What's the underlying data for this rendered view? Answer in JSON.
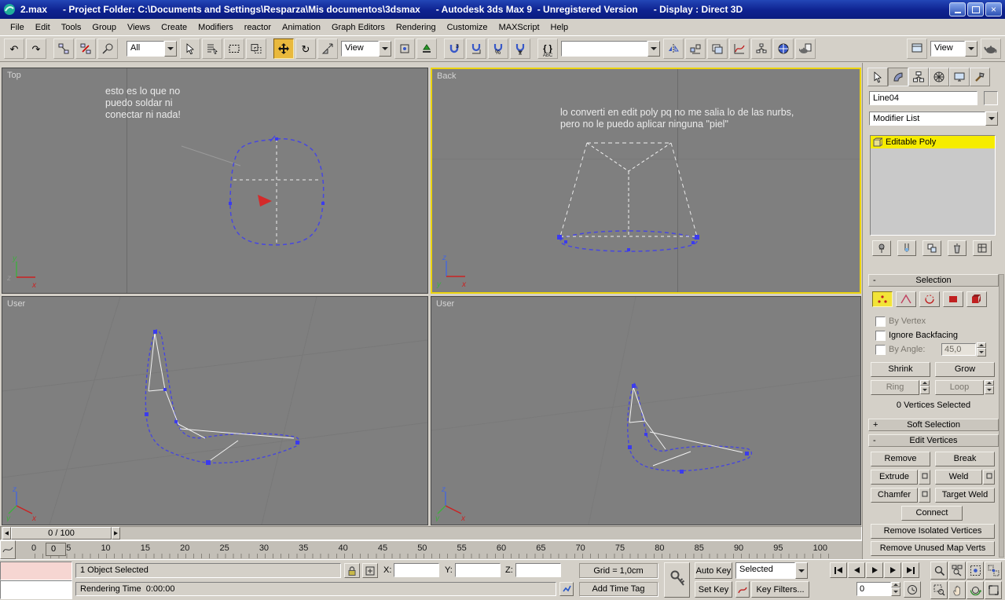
{
  "axes": {
    "x": "x",
    "y": "y",
    "z": "z"
  },
  "title_bar": {
    "title": "2.max      - Project Folder: C:\\Documents and Settings\\Resparza\\Mis documentos\\3dsmax      - Autodesk 3ds Max 9  - Unregistered Version      - Display : Direct 3D"
  },
  "menu": {
    "items": [
      "File",
      "Edit",
      "Tools",
      "Group",
      "Views",
      "Create",
      "Modifiers",
      "reactor",
      "Animation",
      "Graph Editors",
      "Rendering",
      "Customize",
      "MAXScript",
      "Help"
    ]
  },
  "toolbar": {
    "selection_filter": "All",
    "ref_coord": "View",
    "render_preset": "View",
    "named_selection": ""
  },
  "viewports": {
    "top": {
      "label": "Top",
      "annotation_lines": [
        "esto es lo que no",
        "puedo soldar ni",
        "conectar ni nada!"
      ]
    },
    "back": {
      "label": "Back",
      "annotation_lines": [
        "lo converti en edit poly pq no me salia lo de las nurbs,",
        "pero no le puedo aplicar ninguna \"piel\""
      ]
    },
    "user_left": {
      "label": "User"
    },
    "user_right": {
      "label": "User"
    }
  },
  "command_panel": {
    "object_name": "Line04",
    "object_color": "#9adb63",
    "object_color_style": "background:#9adb63",
    "modifier_list": "Modifier List",
    "stack_item": "Editable Poly",
    "selection": {
      "title": "Selection",
      "collapse": "-",
      "by_vertex": "By Vertex",
      "ignore_backfacing": "Ignore Backfacing",
      "by_angle": "By Angle:",
      "by_angle_value": "45,0",
      "shrink": "Shrink",
      "grow": "Grow",
      "ring": "Ring",
      "loop": "Loop",
      "status": "0 Vertices Selected"
    },
    "soft_selection": {
      "title": "Soft Selection",
      "collapse": "+"
    },
    "edit_vertices": {
      "title": "Edit Vertices",
      "collapse": "-",
      "remove": "Remove",
      "break": "Break",
      "extrude": "Extrude",
      "weld": "Weld",
      "chamfer": "Chamfer",
      "target_weld": "Target Weld",
      "connect": "Connect",
      "remove_isolated": "Remove Isolated Vertices",
      "remove_unused": "Remove Unused Map Verts"
    }
  },
  "timeline": {
    "slider": "0 / 100",
    "current_frame": "0",
    "ticks": [
      "0",
      "5",
      "10",
      "15",
      "20",
      "25",
      "30",
      "35",
      "40",
      "45",
      "50",
      "55",
      "60",
      "65",
      "70",
      "75",
      "80",
      "85",
      "90",
      "95",
      "100"
    ]
  },
  "status": {
    "selection": "1 Object Selected",
    "x": "X:",
    "y": "Y:",
    "z": "Z:",
    "grid": "Grid = 1,0cm",
    "prompt": "Rendering Time  0:00:00",
    "add_time_tag": "Add Time Tag",
    "auto_key": "Auto Key",
    "set_key": "Set Key",
    "key_filters": "Key Filters...",
    "selected": "Selected",
    "frame": "0"
  }
}
